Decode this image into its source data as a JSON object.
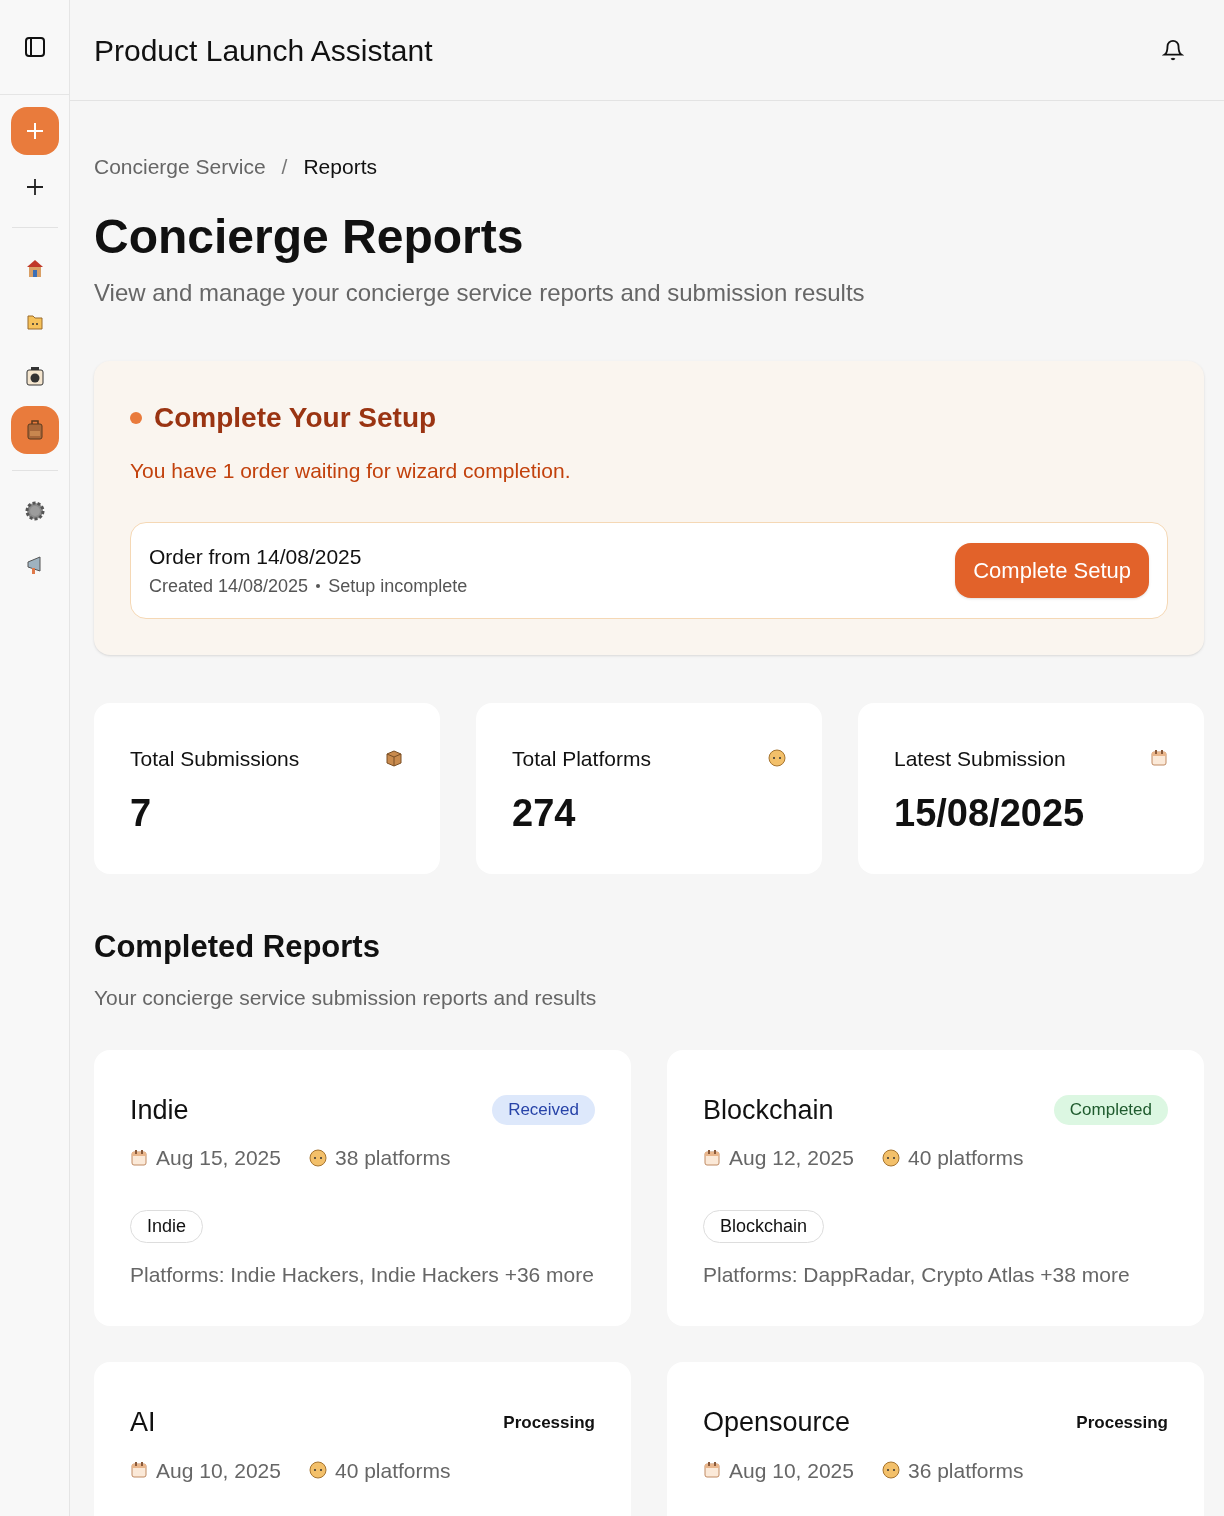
{
  "header": {
    "title": "Product Launch Assistant"
  },
  "sidebar": {
    "items": [
      {
        "kind": "house",
        "selected": false
      },
      {
        "kind": "folder",
        "selected": false
      },
      {
        "kind": "camera",
        "selected": false
      },
      {
        "kind": "briefcase",
        "selected": true
      }
    ],
    "bottom_items": [
      {
        "kind": "gear",
        "selected": false
      },
      {
        "kind": "megaphone",
        "selected": false
      }
    ]
  },
  "breadcrumb": {
    "items": [
      "Concierge Service",
      "Reports"
    ],
    "separator": "/"
  },
  "page": {
    "title": "Concierge Reports",
    "subtitle": "View and manage your concierge service reports and submission results"
  },
  "setup": {
    "title": "Complete Your Setup",
    "message": "You have 1 order waiting for wizard completion.",
    "order": {
      "title": "Order from 14/08/2025",
      "created": "Created 14/08/2025",
      "status": "Setup incomplete"
    },
    "button": "Complete Setup"
  },
  "stats": [
    {
      "label": "Total Submissions",
      "value": "7",
      "kind": "box"
    },
    {
      "label": "Total Platforms",
      "value": "274",
      "kind": "face"
    },
    {
      "label": "Latest Submission",
      "value": "15/08/2025",
      "kind": "calendar"
    }
  ],
  "reports_section": {
    "title": "Completed Reports",
    "subtitle": "Your concierge service submission reports and results"
  },
  "reports": [
    {
      "title": "Indie",
      "status": "Received",
      "kind": "received",
      "date": "Aug 15, 2025",
      "platforms": "38 platforms",
      "tag": "Indie",
      "platform_list": "Platforms: Indie Hackers, Indie Hackers +36 more"
    },
    {
      "title": "Blockchain",
      "status": "Completed",
      "kind": "completed",
      "date": "Aug 12, 2025",
      "platforms": "40 platforms",
      "tag": "Blockchain",
      "platform_list": "Platforms: DappRadar, Crypto Atlas +38 more"
    },
    {
      "title": "AI",
      "status": "Processing",
      "kind": "processing",
      "date": "Aug 10, 2025",
      "platforms": "40 platforms"
    },
    {
      "title": "Opensource",
      "status": "Processing",
      "kind": "processing",
      "date": "Aug 10, 2025",
      "platforms": "36 platforms"
    }
  ]
}
